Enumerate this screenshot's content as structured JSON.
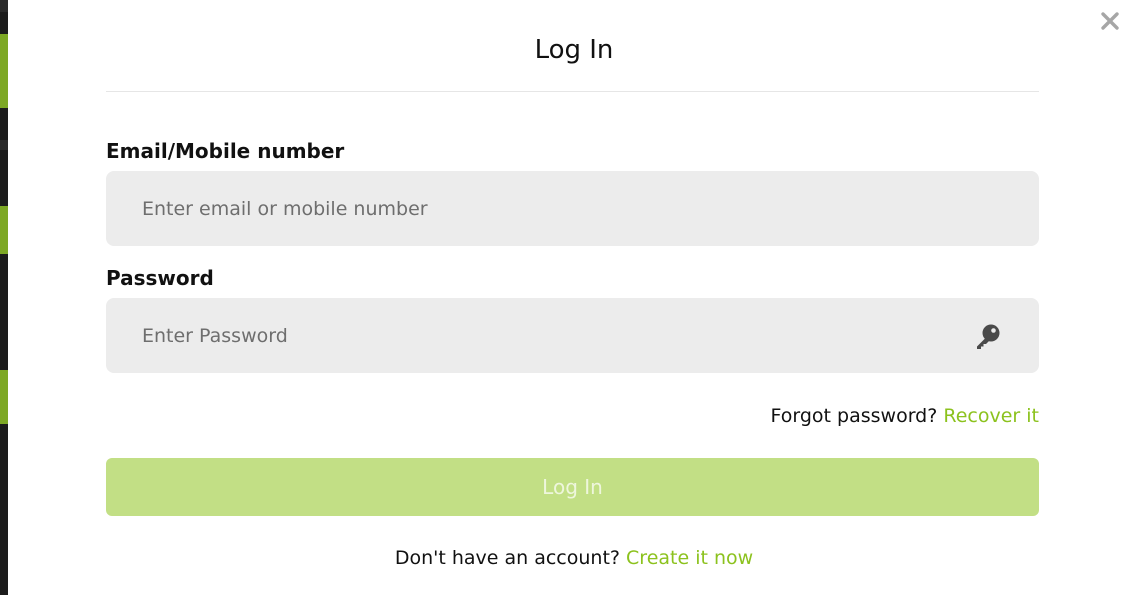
{
  "colors": {
    "accent": "#8cc21e",
    "button_disabled_bg": "#c2df85",
    "input_bg": "#ececec"
  },
  "modal": {
    "title": "Log In",
    "close_icon": "close-icon"
  },
  "form": {
    "email": {
      "label": "Email/Mobile number",
      "placeholder": "Enter email or mobile number",
      "value": ""
    },
    "password": {
      "label": "Password",
      "placeholder": "Enter Password",
      "value": "",
      "icon": "key-icon"
    },
    "forgot": {
      "text": "Forgot password?",
      "link": "Recover it"
    },
    "submit_label": "Log In",
    "signup": {
      "text": "Don't have an account?",
      "link": "Create it now"
    }
  }
}
